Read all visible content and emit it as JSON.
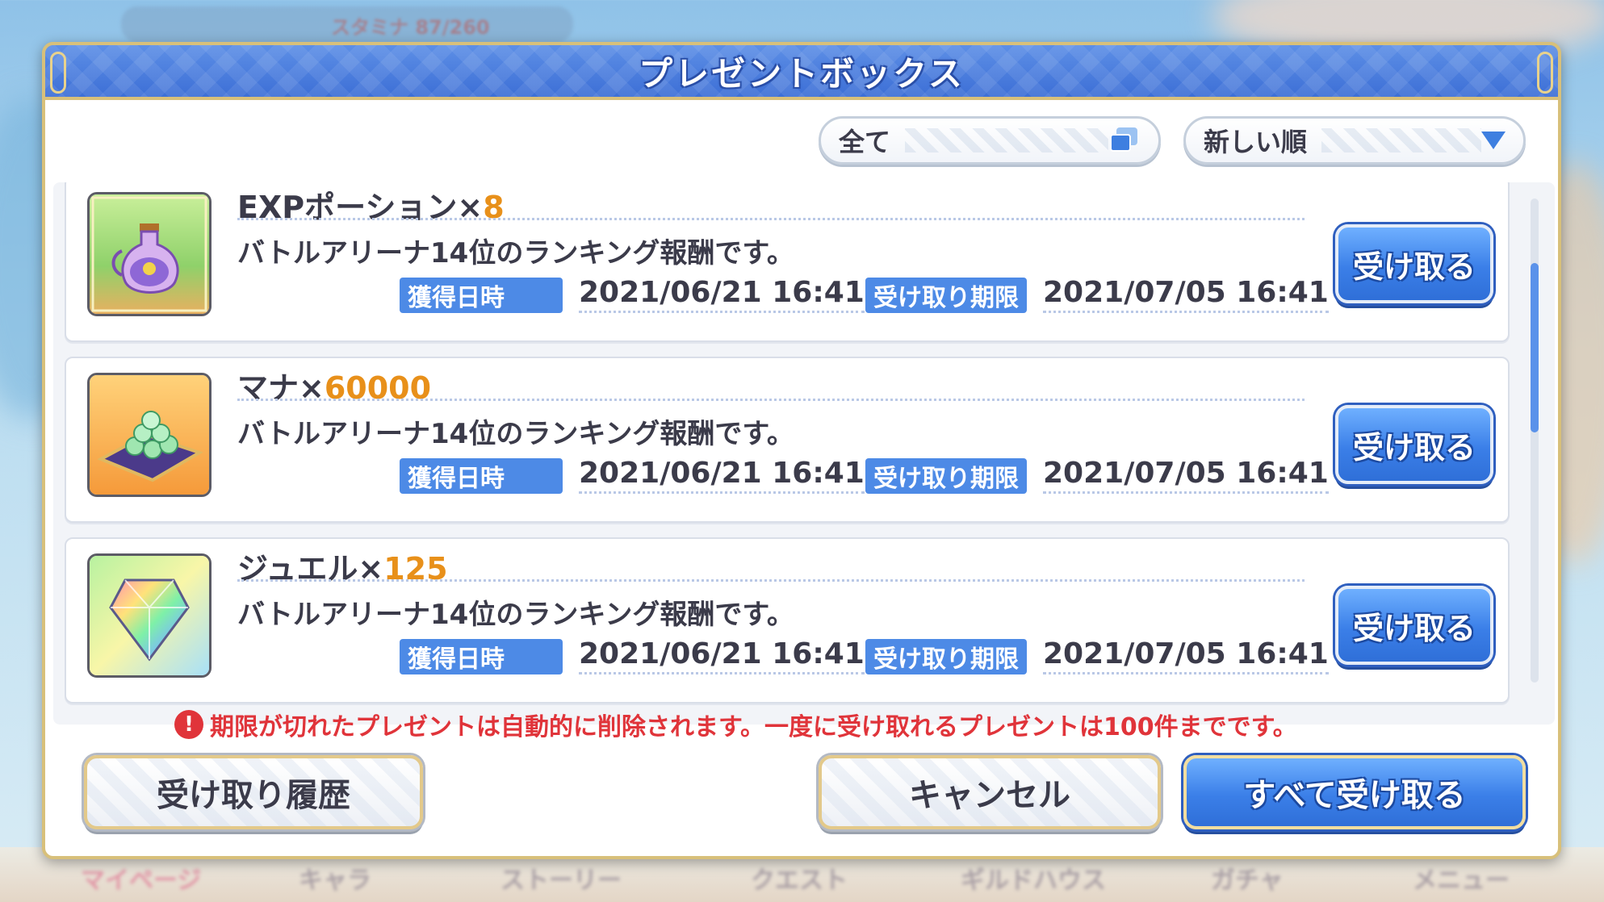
{
  "background": {
    "stamina_text": "スタミナ  87/260",
    "nav_items": [
      "マイページ",
      "キャラ",
      "ストーリー",
      "クエスト",
      "ギルドハウス",
      "ガチャ",
      "メニュー"
    ]
  },
  "dialog": {
    "title": "プレゼントボックス",
    "filter_label": "全て",
    "sort_label": "新しい順"
  },
  "labels": {
    "acquired": "獲得日時",
    "deadline": "受け取り期限",
    "claim": "受け取る"
  },
  "items": [
    {
      "name": "EXPポーション×",
      "qty": "8",
      "desc": "バトルアリーナ14位のランキング報酬です。",
      "acquired_at": "2021/06/21 16:41",
      "deadline_at": "2021/07/05 16:41",
      "icon": "exp-potion-icon"
    },
    {
      "name": "マナ×",
      "qty": "60000",
      "desc": "バトルアリーナ14位のランキング報酬です。",
      "acquired_at": "2021/06/21 16:41",
      "deadline_at": "2021/07/05 16:41",
      "icon": "mana-icon"
    },
    {
      "name": "ジュエル×",
      "qty": "125",
      "desc": "バトルアリーナ14位のランキング報酬です。",
      "acquired_at": "2021/06/21 16:41",
      "deadline_at": "2021/07/05 16:41",
      "icon": "jewel-icon"
    }
  ],
  "notice": "期限が切れたプレゼントは自動的に削除されます。一度に受け取れるプレゼントは100件までです。",
  "buttons": {
    "history": "受け取り履歴",
    "cancel": "キャンセル",
    "claim_all": "すべて受け取る"
  },
  "colors": {
    "accent_blue": "#3b7fe8",
    "qty_orange": "#e8901a",
    "warning_red": "#e0343a",
    "gold_border": "#d8c07a"
  }
}
